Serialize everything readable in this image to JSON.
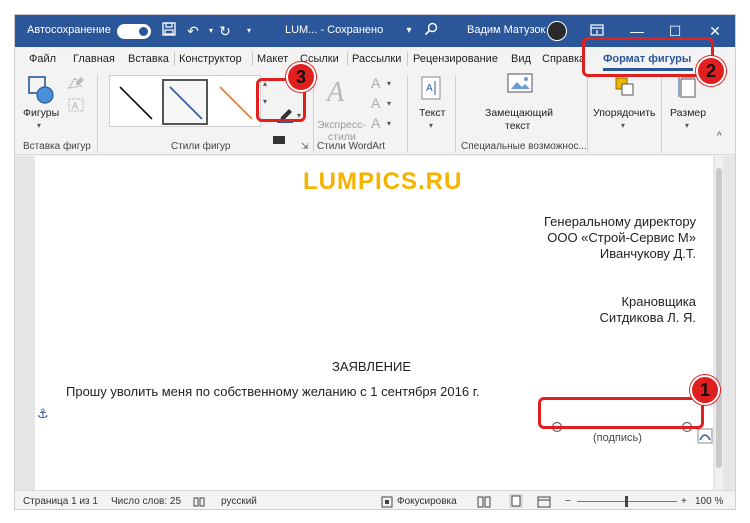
{
  "titlebar": {
    "autosave_label": "Автосохранение",
    "doc_title": "LUM... - Сохранено",
    "user_name": "Вадим Матузок",
    "minimize": "—",
    "maximize": "☐",
    "close": "✕"
  },
  "tabs": [
    {
      "label": "Файл"
    },
    {
      "label": "Главная"
    },
    {
      "label": "Вставка"
    },
    {
      "label": "Конструктор"
    },
    {
      "label": "Макет"
    },
    {
      "label": "Ссылки"
    },
    {
      "label": "Рассылки"
    },
    {
      "label": "Рецензирование"
    },
    {
      "label": "Вид"
    },
    {
      "label": "Справка"
    },
    {
      "label": "Формат фигуры",
      "active": true
    }
  ],
  "ribbon": {
    "insert_shapes": {
      "shapes_label": "Фигуры",
      "group_label": "Вставка фигур"
    },
    "shape_styles": {
      "group_label": "Стили фигур"
    },
    "wordart": {
      "express_label_1": "Экспресс-",
      "express_label_2": "стили",
      "group_label": "Стили WordArt"
    },
    "text": {
      "label": "Текст"
    },
    "accessibility": {
      "alt_text_1": "Замещающий",
      "alt_text_2": "текст",
      "group_label": "Специальные возможнос..."
    },
    "arrange": {
      "label": "Упорядочить"
    },
    "size": {
      "label": "Размер"
    }
  },
  "page": {
    "watermark": "LUMPICS.RU",
    "addressee": [
      "Генеральному директору",
      "ООО «Строй-Сервис М»",
      "Иванчукову Д.Т."
    ],
    "sender": [
      "Крановщика",
      "Ситдикова Л. Я."
    ],
    "heading": "ЗАЯВЛЕНИЕ",
    "body": "Прошу уволить меня по собственному желанию с 1 сентября 2016 г.",
    "signature_caption": "(подпись)"
  },
  "annotations": [
    "1",
    "2",
    "3"
  ],
  "status": {
    "page": "Страница 1 из 1",
    "words": "Число слов: 25",
    "language": "русский",
    "focus": "Фокусировка",
    "zoom": "100 %",
    "zoom_minus": "−",
    "zoom_plus": "+"
  },
  "colors": {
    "accent": "#2b579a",
    "annotation": "#e0201f",
    "watermark": "#f5b300"
  }
}
